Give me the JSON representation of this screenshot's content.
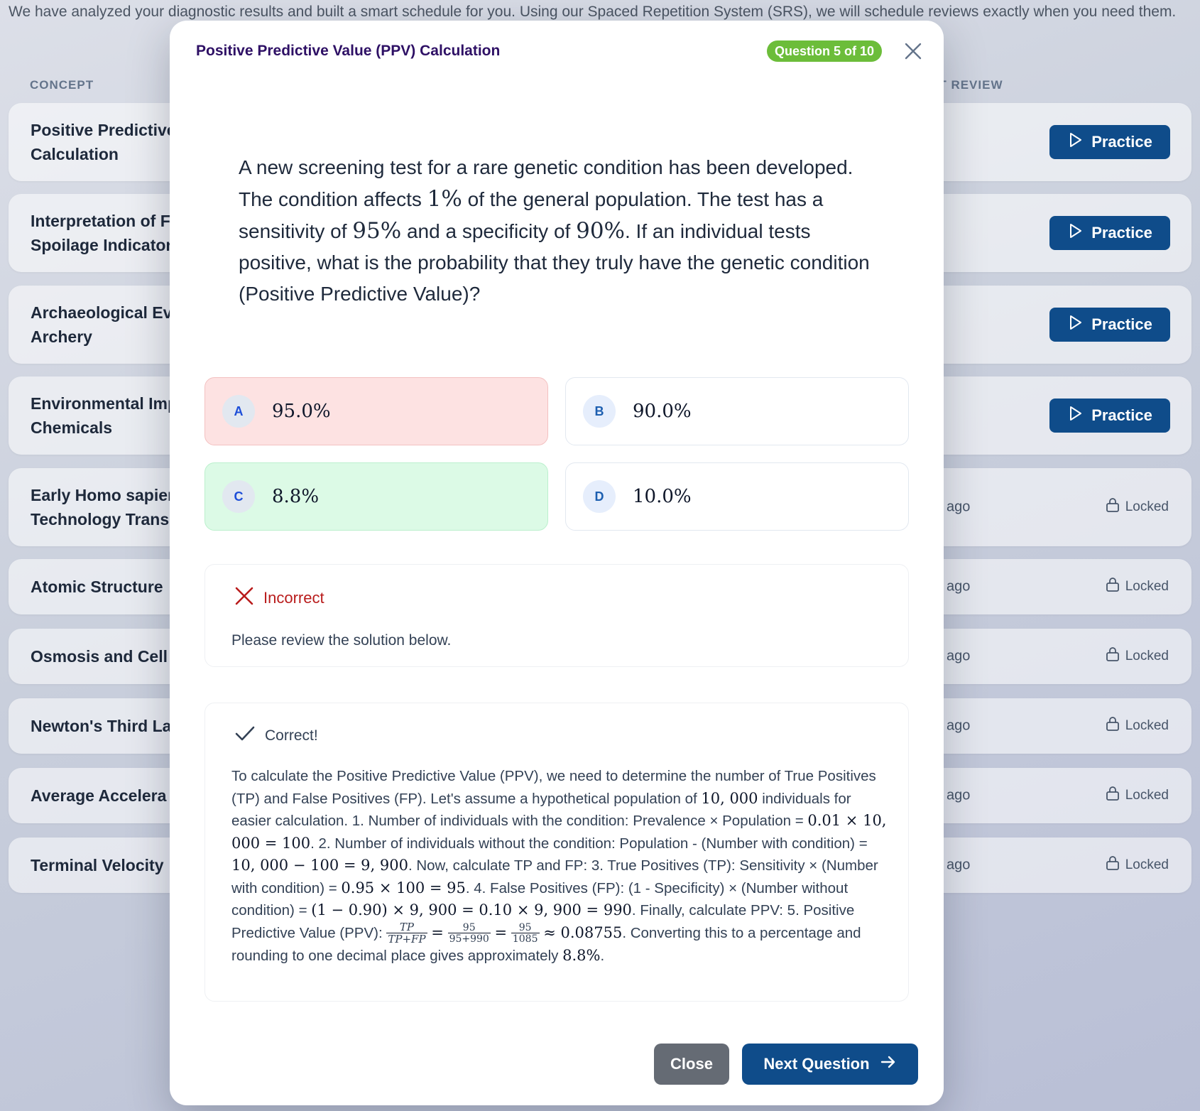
{
  "background": {
    "intro": "We have analyzed your diagnostic results and built a smart schedule for you. Using our Spaced Repetition System (SRS), we will schedule reviews exactly when you need them.",
    "col_concept": "CONCEPT",
    "col_next_review": "XT REVIEW",
    "rows": [
      {
        "concept": "Positive Predictive Calculation",
        "action": "Practice"
      },
      {
        "concept": "Interpretation of F Spoilage Indicator",
        "action": "Practice"
      },
      {
        "concept": "Archaeological Ev Archery",
        "action": "Practice"
      },
      {
        "concept": "Environmental Imp Chemicals",
        "action": "Practice"
      },
      {
        "concept": "Early Homo sapier Technology Trans",
        "next": "ago",
        "action": "Locked"
      },
      {
        "concept": "Atomic Structure",
        "next": "ago",
        "action": "Locked"
      },
      {
        "concept": "Osmosis and Cell",
        "next": "ago",
        "action": "Locked"
      },
      {
        "concept": "Newton's Third La",
        "next": "ago",
        "action": "Locked"
      },
      {
        "concept": "Average Accelera",
        "next": "ago",
        "action": "Locked"
      },
      {
        "concept": "Terminal Velocity",
        "next": "ago",
        "action": "Locked"
      }
    ]
  },
  "modal": {
    "title": "Positive Predictive Value (PPV) Calculation",
    "badge": "Question 5 of 10",
    "question": {
      "p1": "A new screening test for a rare genetic condition has been developed. The condition affects ",
      "m1": "1%",
      "p2": " of the general population. The test has a sensitivity of ",
      "m2": "95%",
      "p3": " and a specificity of ",
      "m3": "90%",
      "p4": ". If an individual tests positive, what is the probability that they truly have the genetic condition (Positive Predictive Value)?"
    },
    "options": [
      {
        "letter": "A",
        "value": "95.0%",
        "state": "wrong"
      },
      {
        "letter": "B",
        "value": "90.0%",
        "state": "plain"
      },
      {
        "letter": "C",
        "value": "8.8%",
        "state": "right"
      },
      {
        "letter": "D",
        "value": "10.0%",
        "state": "plain"
      }
    ],
    "feedback": {
      "status": "Incorrect",
      "message": "Please review the solution below."
    },
    "solution": {
      "status": "Correct!",
      "t1": "To calculate the Positive Predictive Value (PPV), we need to determine the number of True Positives (TP) and False Positives (FP). Let's assume a hypothetical population of ",
      "m1": "10, 000",
      "t2": " individuals for easier calculation. 1. Number of individuals with the condition: Prevalence × Population = ",
      "m2": "0.01 × 10, 000 = 100",
      "t3": ". 2. Number of individuals without the condition: Population - (Number with condition) = ",
      "m3": "10, 000 − 100 = 9, 900",
      "t4": ". Now, calculate TP and FP: 3. True Positives (TP): Sensitivity × (Number with condition) = ",
      "m4": "0.95 × 100 = 95",
      "t5": ". 4. False Positives (FP): (1 - Specificity) × (Number without condition) = ",
      "m5": "(1 − 0.90) × 9, 900 = 0.10 × 9, 900 = 990",
      "t6": ". Finally, calculate PPV: 5. Positive Predictive Value (PPV): ",
      "f1_num": "TP",
      "f1_den": "TP+FP",
      "eq": "=",
      "f2_num": "95",
      "f2_den": "95+990",
      "f3_num": "95",
      "f3_den": "1085",
      "m6": "≈ 0.08755",
      "t7": ". Converting this to a percentage and rounding to one decimal place gives approximately ",
      "m7": "8.8%",
      "t8": "."
    },
    "close_label": "Close",
    "next_label": "Next Question"
  }
}
